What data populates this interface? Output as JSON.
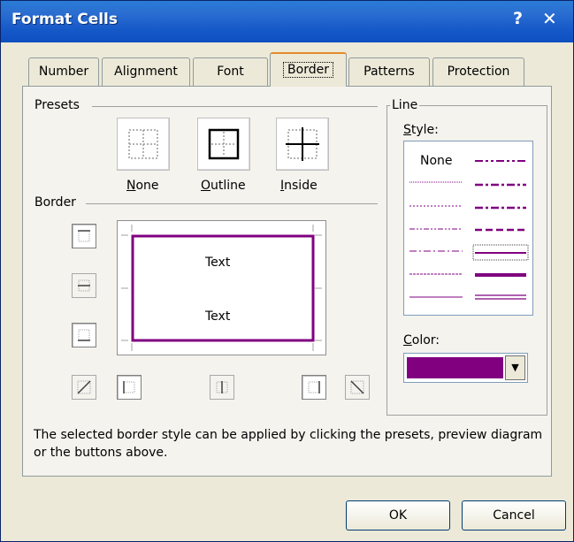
{
  "dialog": {
    "title": "Format Cells",
    "help": "?",
    "close": "✕"
  },
  "tabs": [
    {
      "label": "Number",
      "active": false
    },
    {
      "label": "Alignment",
      "active": false
    },
    {
      "label": "Font",
      "active": false
    },
    {
      "label": "Border",
      "active": true
    },
    {
      "label": "Patterns",
      "active": false
    },
    {
      "label": "Protection",
      "active": false
    }
  ],
  "presets": {
    "heading": "Presets",
    "none": {
      "accel": "N",
      "rest": "one"
    },
    "outline": {
      "accel": "O",
      "rest": "utline"
    },
    "inside": {
      "accel": "I",
      "rest": "nside"
    }
  },
  "border": {
    "heading": "Border",
    "preview_text_top": "Text",
    "preview_text_bottom": "Text",
    "color": "#800080"
  },
  "line": {
    "heading": "Line",
    "style": {
      "accel": "S",
      "rest": "tyle:"
    },
    "none_label": "None",
    "color": {
      "accel": "C",
      "rest": "olor:"
    },
    "selected_color": "#800080"
  },
  "description": "The selected border style can be applied by clicking the presets, preview diagram or the buttons above.",
  "buttons": {
    "ok": "OK",
    "cancel": "Cancel"
  },
  "icons": [
    "border-top-icon",
    "border-inner-horizontal-icon",
    "border-bottom-icon",
    "border-diagonal-up-icon",
    "border-left-icon",
    "border-inner-vertical-icon",
    "border-right-icon",
    "border-diagonal-down-icon"
  ]
}
